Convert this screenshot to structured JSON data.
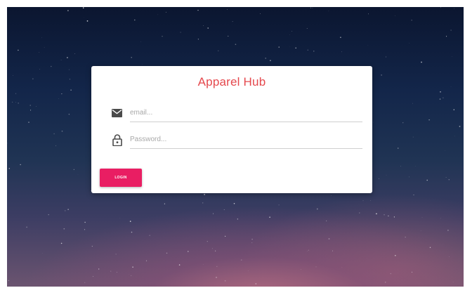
{
  "app": {
    "title": "Apparel Hub"
  },
  "login_form": {
    "email": {
      "value": "",
      "placeholder": "email...",
      "icon": "envelope-icon"
    },
    "password": {
      "value": "",
      "placeholder": "Password...",
      "icon": "lock-icon"
    },
    "submit_label": "LOGIN"
  },
  "colors": {
    "title": "#e5484d",
    "button": "#e91e63",
    "icon": "#4a4a4a",
    "card": "#ffffff",
    "sky_top": "#0b1630",
    "sky_glow": "#be6e82"
  }
}
